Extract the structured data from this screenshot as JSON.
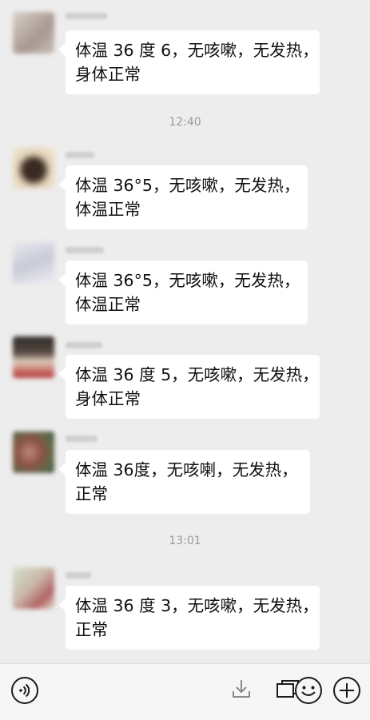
{
  "messages": [
    {
      "lines": [
        "体温 36 度 6，无咳嗽，无发热，",
        "身体正常"
      ]
    },
    {
      "lines": [
        "体温 36°5，无咳嗽，无发热，",
        "体温正常"
      ]
    },
    {
      "lines": [
        "体温 36°5，无咳嗽，无发热，",
        "体温正常"
      ]
    },
    {
      "lines": [
        "体温 36 度 5，无咳嗽，无发热，",
        "身体正常"
      ]
    },
    {
      "lines": [
        "体温 36度，无咳喇，无发热，",
        "正常"
      ]
    },
    {
      "lines": [
        "体温 36 度 3，无咳嗽，无发热，",
        "正常"
      ]
    }
  ],
  "timestamps": [
    "12:40",
    "13:01"
  ],
  "bottom_bar": {
    "icons": [
      "voice-icon",
      "download-icon",
      "window-icon",
      "emoji-icon",
      "plus-icon"
    ]
  },
  "colors": {
    "background": "#ededed",
    "bubble": "#ffffff",
    "timestamp": "#9a9a9a"
  }
}
